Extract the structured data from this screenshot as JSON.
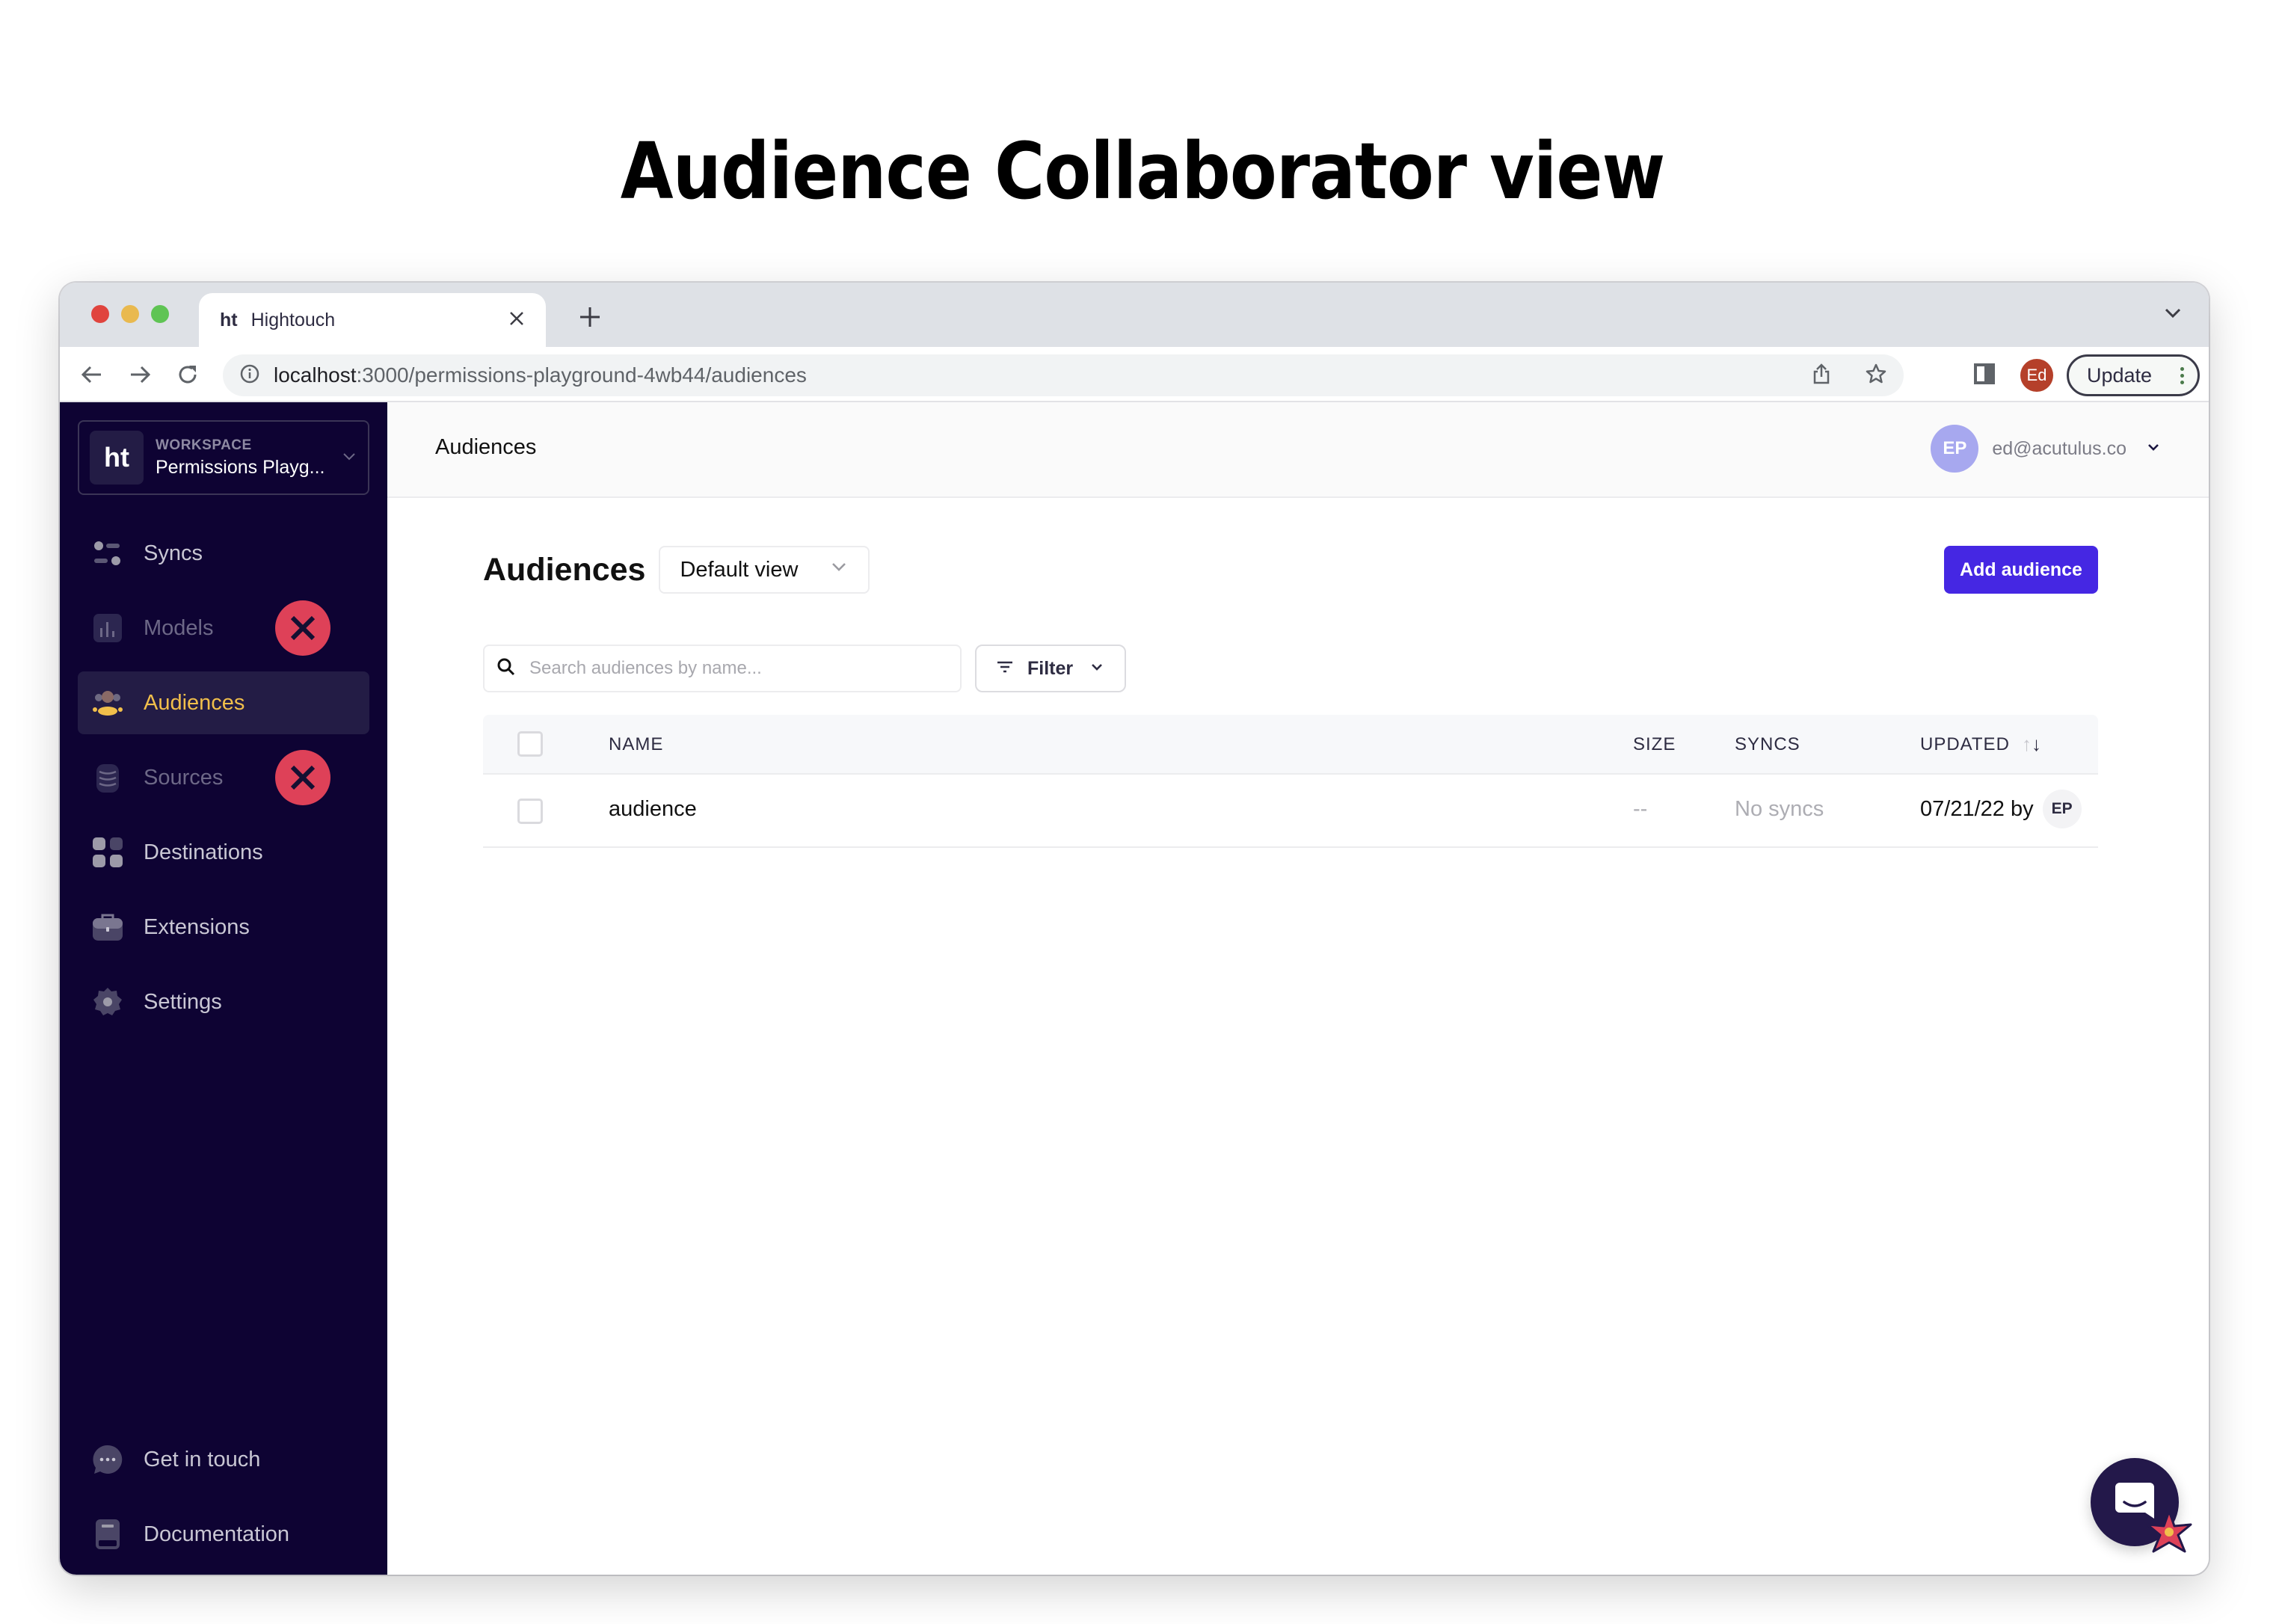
{
  "heading": "Audience Collaborator view",
  "browser": {
    "tab": {
      "favicon": "ht",
      "title": "Hightouch",
      "close_icon": "close-icon"
    },
    "new_tab_icon": "plus-icon",
    "url_host": "localhost",
    "url_path": ":3000/permissions-playground-4wb44/audiences",
    "profile_initials": "Ed",
    "profile_color": "#b5402a",
    "update_label": "Update"
  },
  "sidebar": {
    "workspace": {
      "logo": "ht",
      "label": "WORKSPACE",
      "name": "Permissions Playg..."
    },
    "items": [
      {
        "label": "Syncs",
        "icon": "syncs-icon",
        "state": "enabled",
        "denied": false
      },
      {
        "label": "Models",
        "icon": "models-icon",
        "state": "disabled",
        "denied": true
      },
      {
        "label": "Audiences",
        "icon": "audiences-icon",
        "state": "active",
        "denied": false
      },
      {
        "label": "Sources",
        "icon": "database-icon",
        "state": "disabled",
        "denied": true
      },
      {
        "label": "Destinations",
        "icon": "grid-icon",
        "state": "enabled",
        "denied": false
      },
      {
        "label": "Extensions",
        "icon": "briefcase-icon",
        "state": "enabled",
        "denied": false
      },
      {
        "label": "Settings",
        "icon": "gear-icon",
        "state": "enabled",
        "denied": false
      }
    ],
    "bottom_items": [
      {
        "label": "Get in touch",
        "icon": "chat-bubble-icon"
      },
      {
        "label": "Documentation",
        "icon": "book-icon"
      }
    ]
  },
  "topbar": {
    "breadcrumb": "Audiences",
    "user": {
      "initials": "EP",
      "email": "ed@acutulus.co"
    }
  },
  "main": {
    "title": "Audiences",
    "view_select": "Default view",
    "add_button": "Add audience",
    "search_placeholder": "Search audiences by name...",
    "filter_label": "Filter",
    "table": {
      "columns": [
        "NAME",
        "SIZE",
        "SYNCS",
        "UPDATED"
      ],
      "sort_icon": "↑↓",
      "rows": [
        {
          "name": "audience",
          "size": "--",
          "syncs": "No syncs",
          "updated": "07/21/22",
          "by_label": "by",
          "updated_by": "EP"
        }
      ]
    }
  },
  "colors": {
    "sidebar_bg": "#0e0333",
    "active_accent": "#f1bf4b",
    "primary_button": "#4527e3",
    "deny_badge": "#de4158"
  }
}
